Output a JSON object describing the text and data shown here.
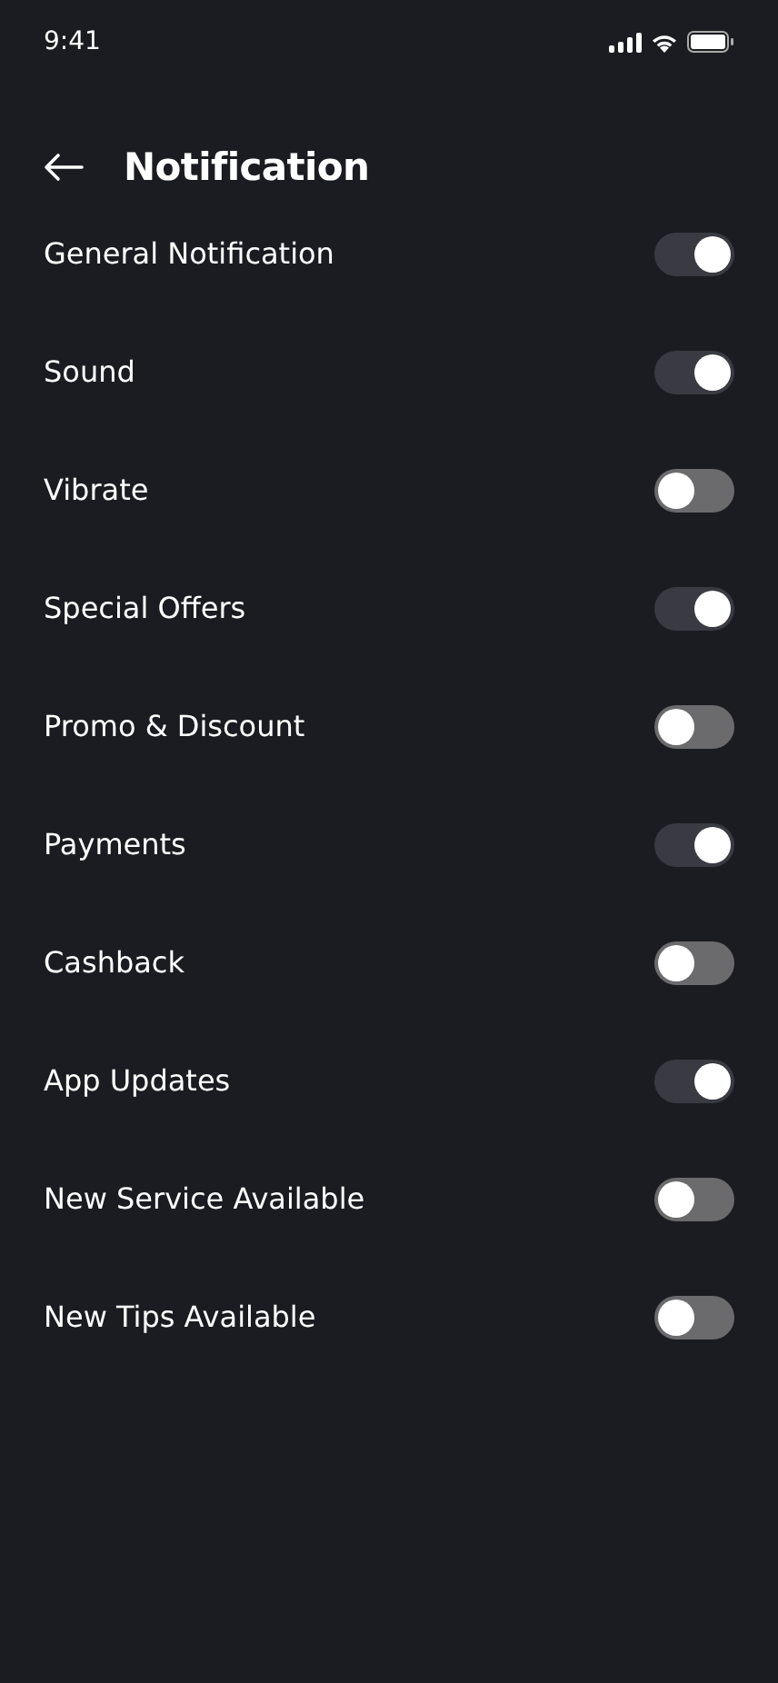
{
  "status_bar": {
    "time": "9:41"
  },
  "header": {
    "title": "Notification"
  },
  "settings": [
    {
      "label": "General Notification",
      "on": true
    },
    {
      "label": "Sound",
      "on": true
    },
    {
      "label": "Vibrate",
      "on": false
    },
    {
      "label": "Special Offers",
      "on": true
    },
    {
      "label": "Promo & Discount",
      "on": false
    },
    {
      "label": "Payments",
      "on": true
    },
    {
      "label": "Cashback",
      "on": false
    },
    {
      "label": "App Updates",
      "on": true
    },
    {
      "label": "New Service Available",
      "on": false
    },
    {
      "label": "New Tips Available",
      "on": false
    }
  ]
}
